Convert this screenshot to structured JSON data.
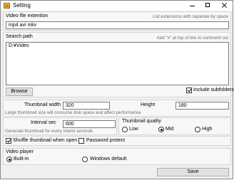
{
  "window": {
    "title": "Setting"
  },
  "video_ext": {
    "label": "Video file extention",
    "hint": "List extensions with separate by space",
    "value": "mp4 avi mkv"
  },
  "search_path": {
    "label": "Search path",
    "hint": "Add \"#\" at top of line to comment out",
    "value": "D:¥Video",
    "browse_label": "Browse",
    "include_subfolders_label": "Include subfolders",
    "include_subfolders_checked": true
  },
  "thumbnail": {
    "width_label": "Thumbnail width",
    "width_value": "320",
    "height_label": "Height",
    "height_value": "180",
    "size_hint": "Large thumbnail size will consume disk space and affect performance"
  },
  "interval": {
    "label": "Interval sec",
    "value": "600",
    "hint": "Generate thumbnail for every intervl seconds"
  },
  "quality": {
    "label": "Thumbnail quality",
    "options": [
      "Low",
      "Mid",
      "High"
    ],
    "selected": "Mid"
  },
  "options": {
    "shuffle_label": "Shuffle thumbnail when open",
    "shuffle_checked": true,
    "password_label": "Password protect",
    "password_checked": false
  },
  "video_player": {
    "label": "Video player",
    "options": [
      "Built-in",
      "Windows default"
    ],
    "selected": "Built-in"
  },
  "save_label": "Save"
}
